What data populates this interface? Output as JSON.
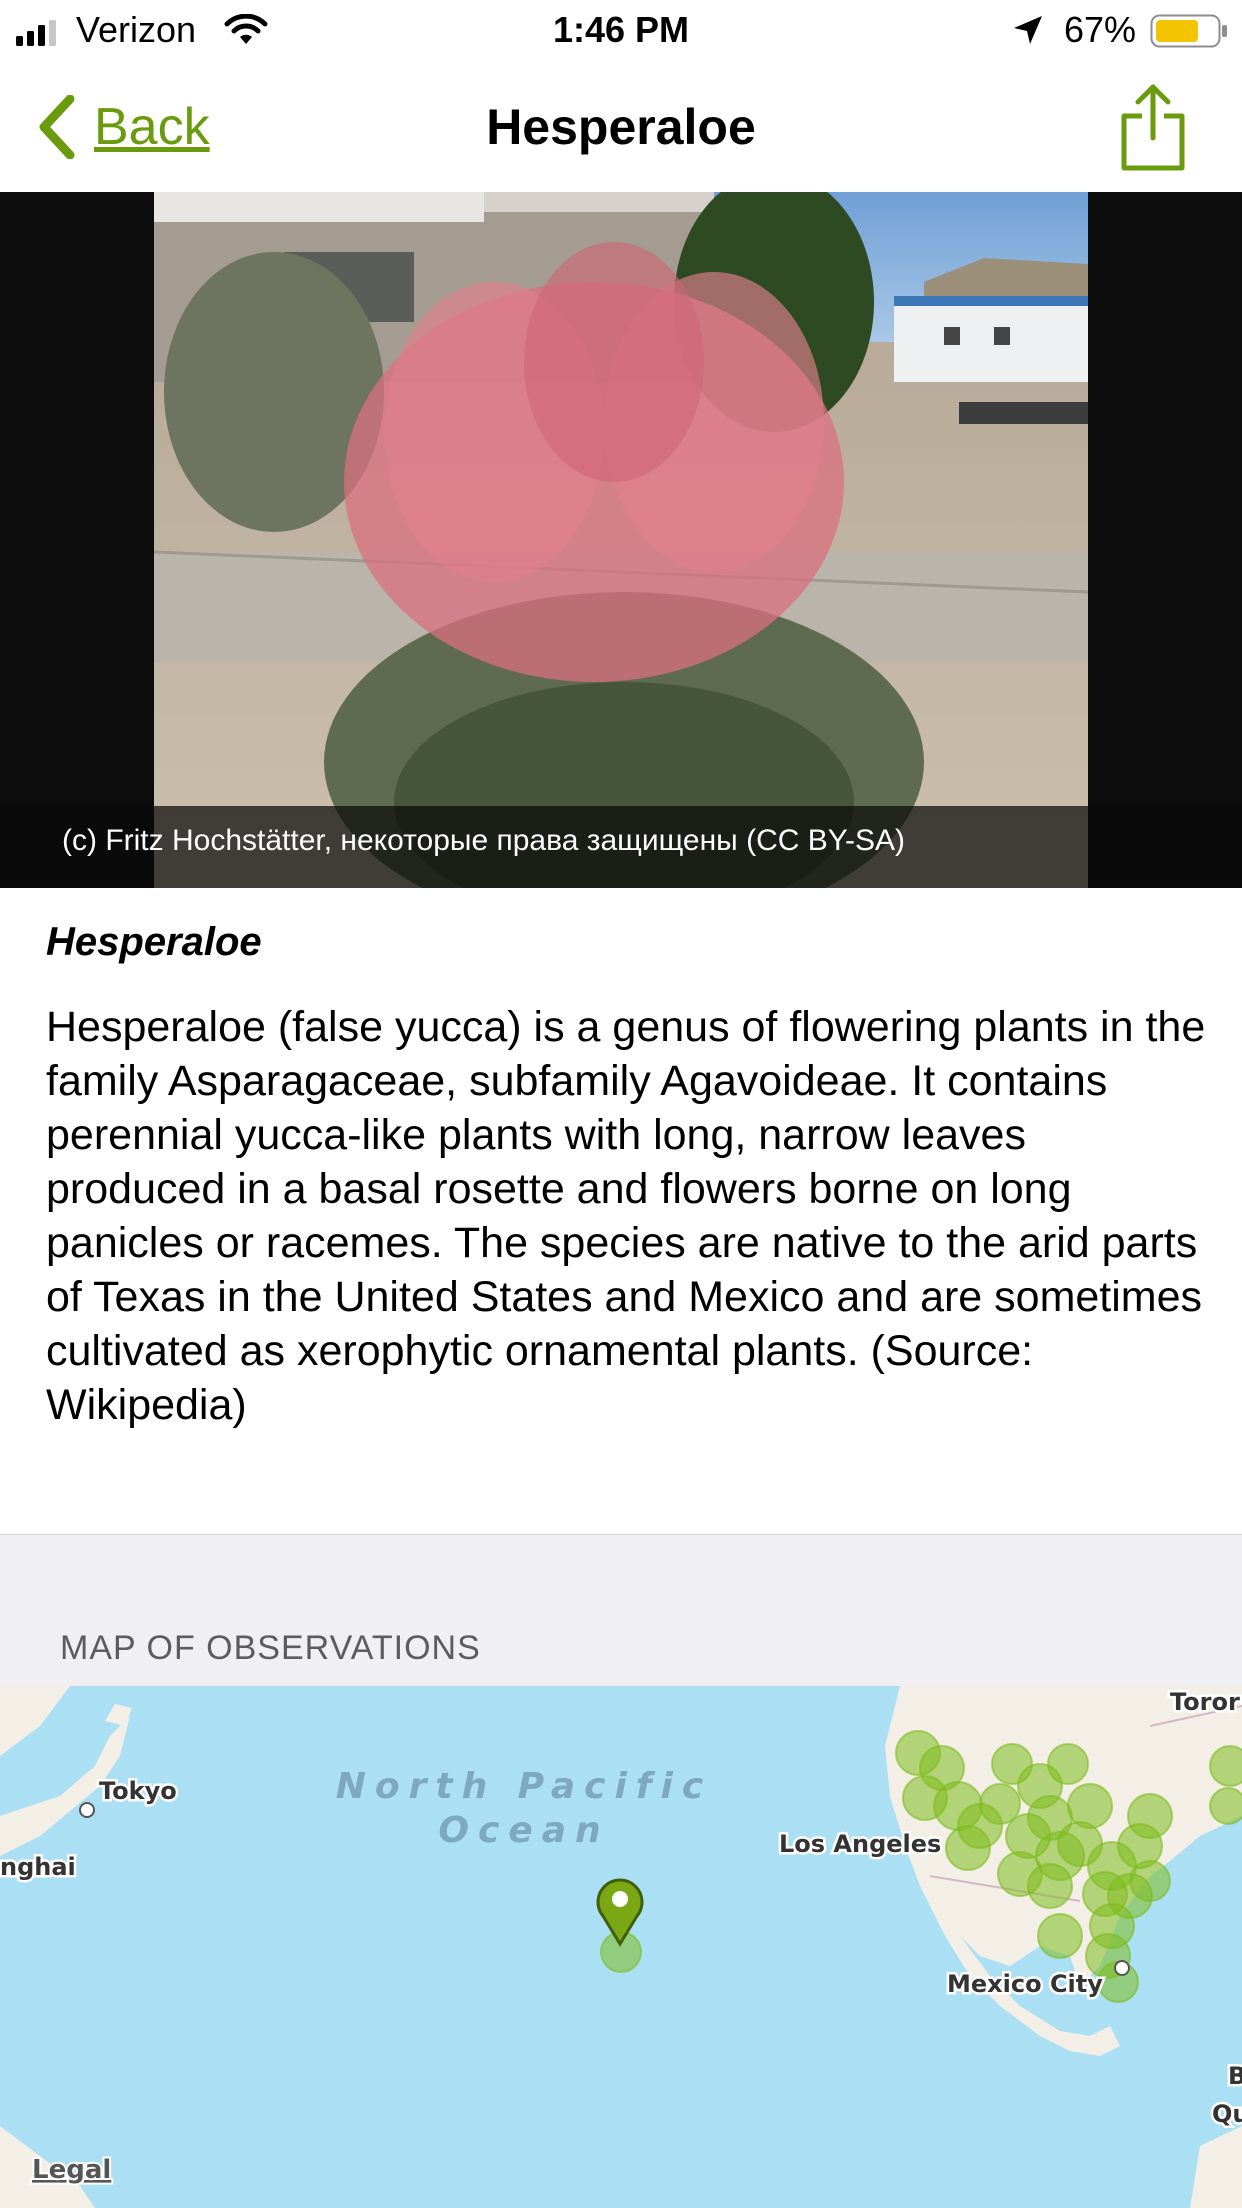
{
  "status_bar": {
    "carrier": "Verizon",
    "time": "1:46 PM",
    "battery": "67%",
    "battery_level": 0.67
  },
  "nav": {
    "back_label": "Back",
    "title": "Hesperaloe"
  },
  "photo": {
    "credit": "(c) Fritz Hochstätter, некоторые права защищены (CC BY-SA)"
  },
  "taxon": {
    "scientific_name": "Hesperaloe",
    "description": "Hesperaloe (false yucca) is a genus of flowering plants in the family Asparagaceae, subfamily Agavoideae. It contains perennial yucca-like plants with long, narrow leaves produced in a basal rosette and flowers borne on long panicles or racemes. The species are native to the arid parts of Texas in the United States and Mexico and are sometimes cultivated as xerophytic ornamental plants. (Source: Wikipedia)"
  },
  "map_section": {
    "header": "MAP OF OBSERVATIONS",
    "labels": {
      "tokyo": "Tokyo",
      "shanghai": "nghai",
      "ocean_line1": "North Pacific",
      "ocean_line2": "Ocean",
      "los_angeles": "Los Angeles",
      "mexico_city": "Mexico City",
      "toronto": "Toror",
      "edge_b": "B",
      "edge_qu": "Qu",
      "legal": "Legal"
    }
  },
  "colors": {
    "accent": "#6a9b0c",
    "map_water": "#aadff4",
    "land": "#f4efe6",
    "observation": "#7dbb1e"
  }
}
